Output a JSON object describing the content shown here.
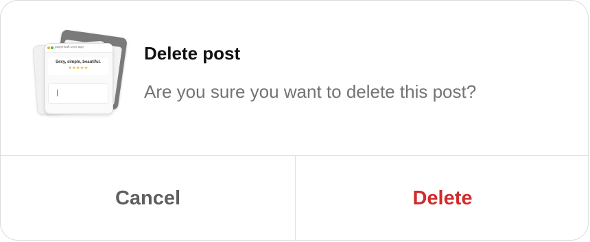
{
  "dialog": {
    "title": "Delete post",
    "message": "Are you sure you want to delete this post?",
    "thumbnail": {
      "icon": "post-preview-thumbnail",
      "url_text": "paperwall.com.app",
      "tagline": "Sexy, simple, beautiful.",
      "stars": "★★★★★"
    },
    "actions": {
      "cancel_label": "Cancel",
      "delete_label": "Delete"
    },
    "colors": {
      "destructive": "#d42a2a",
      "title": "#111111",
      "message": "#737373",
      "cancel": "#5f5f5f",
      "stars": "#f2b01e"
    }
  }
}
